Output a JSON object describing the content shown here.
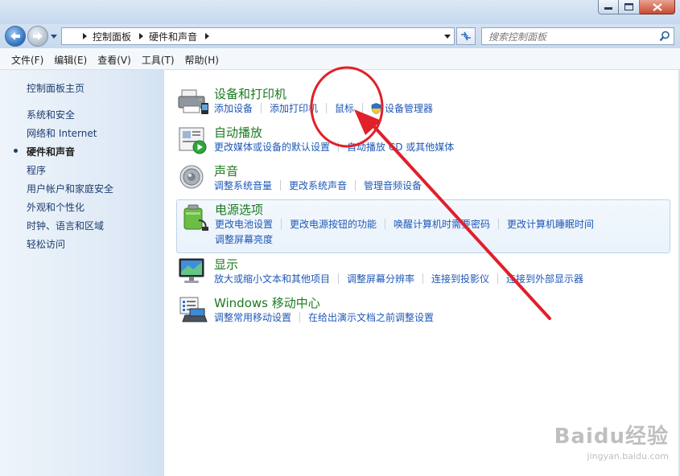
{
  "window": {
    "controls": {
      "minimize": "minimize-icon",
      "maximize": "maximize-icon",
      "close": "close-icon"
    }
  },
  "nav": {
    "breadcrumb": [
      "控制面板",
      "硬件和声音"
    ],
    "search_placeholder": "搜索控制面板"
  },
  "menu": [
    "文件(F)",
    "编辑(E)",
    "查看(V)",
    "工具(T)",
    "帮助(H)"
  ],
  "sidebar": {
    "items": [
      {
        "label": "控制面板主页"
      },
      {
        "label": "系统和安全"
      },
      {
        "label": "网络和 Internet"
      },
      {
        "label": "硬件和声音",
        "active": true
      },
      {
        "label": "程序"
      },
      {
        "label": "用户帐户和家庭安全"
      },
      {
        "label": "外观和个性化"
      },
      {
        "label": "时钟、语言和区域"
      },
      {
        "label": "轻松访问"
      }
    ]
  },
  "categories": [
    {
      "title": "设备和打印机",
      "icon": "printer-icon",
      "links": [
        "添加设备",
        "添加打印机",
        "鼠标",
        "设备管理器"
      ]
    },
    {
      "title": "自动播放",
      "icon": "autoplay-icon",
      "links": [
        "更改媒体或设备的默认设置",
        "自动播放 CD 或其他媒体"
      ]
    },
    {
      "title": "声音",
      "icon": "speaker-icon",
      "links": [
        "调整系统音量",
        "更改系统声音",
        "管理音频设备"
      ]
    },
    {
      "title": "电源选项",
      "icon": "battery-icon",
      "links": [
        "更改电池设置",
        "更改电源按钮的功能",
        "唤醒计算机时需要密码",
        "更改计算机睡眠时间",
        "调整屏幕亮度"
      ]
    },
    {
      "title": "显示",
      "icon": "monitor-icon",
      "links": [
        "放大或缩小文本和其他项目",
        "调整屏幕分辨率",
        "连接到投影仪",
        "连接到外部显示器"
      ]
    },
    {
      "title": "Windows 移动中心",
      "icon": "mobility-center-icon",
      "links": [
        "调整常用移动设置",
        "在给出演示文档之前调整设置"
      ]
    }
  ],
  "watermark": {
    "brand": "Baidu经验",
    "site": "jingyan.baidu.com"
  },
  "colors": {
    "category_title": "#1c7a22",
    "link": "#1f58b6",
    "annotation": "#e0202a"
  }
}
